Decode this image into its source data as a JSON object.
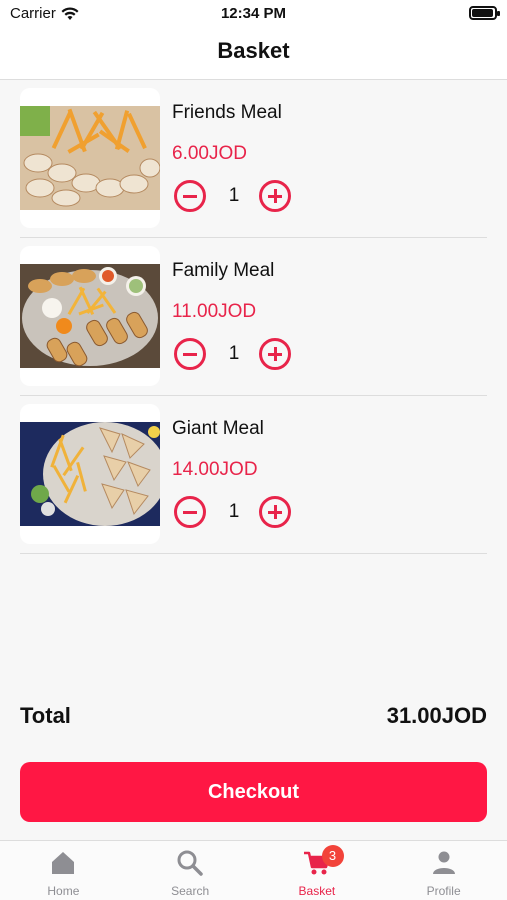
{
  "status": {
    "carrier": "Carrier",
    "time": "12:34 PM",
    "battery_level": 0.95
  },
  "nav": {
    "title": "Basket"
  },
  "items": [
    {
      "name": "Friends Meal",
      "price": "6.00JOD",
      "quantity": "1"
    },
    {
      "name": "Family Meal",
      "price": "11.00JOD",
      "quantity": "1"
    },
    {
      "name": "Giant Meal",
      "price": "14.00JOD",
      "quantity": "1"
    }
  ],
  "total": {
    "label": "Total",
    "value": "31.00JOD"
  },
  "checkout": {
    "label": "Checkout"
  },
  "tabs": [
    {
      "label": "Home",
      "icon": "home-icon",
      "active": false
    },
    {
      "label": "Search",
      "icon": "search-icon",
      "active": false
    },
    {
      "label": "Basket",
      "icon": "cart-icon",
      "active": true,
      "badge": "3"
    },
    {
      "label": "Profile",
      "icon": "profile-icon",
      "active": false
    }
  ],
  "colors": {
    "accent": "#e8244a",
    "checkout_bg": "#ff1744",
    "badge_bg": "#f2433a",
    "inactive_tab": "#8e8e93"
  }
}
